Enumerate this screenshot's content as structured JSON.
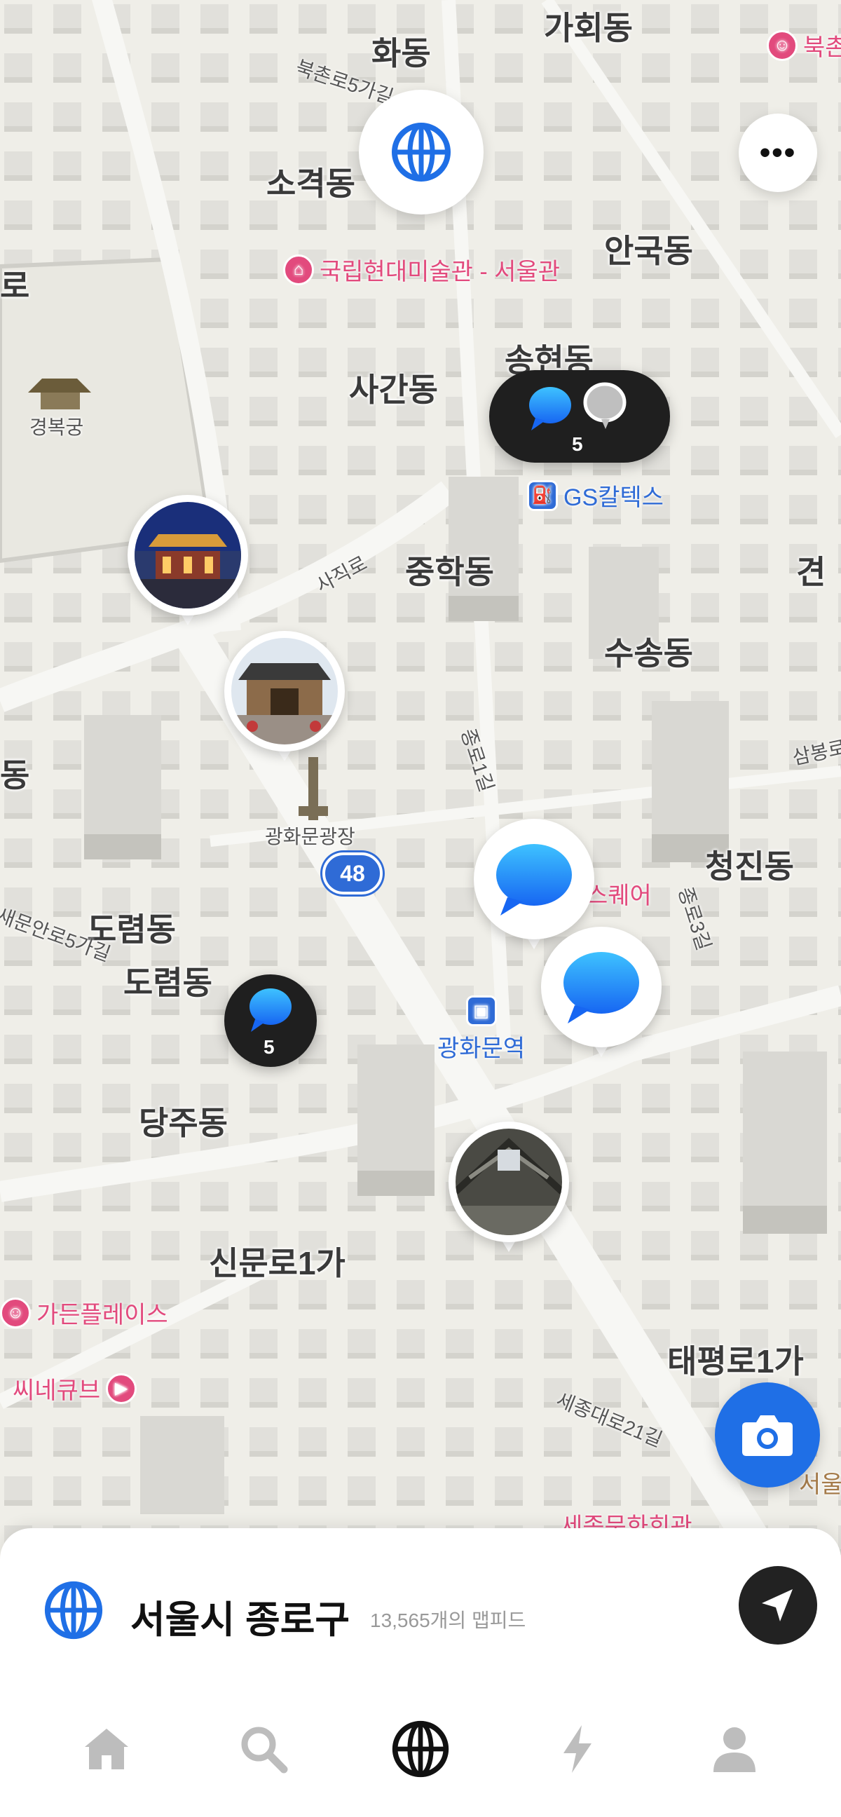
{
  "map": {
    "places": {
      "hwadong": "화동",
      "gahoedong": "가회동",
      "sogyeokdong": "소격동",
      "angukdong": "안국동",
      "saganDong": "사간동",
      "songhyeondong": "송현동",
      "junghakdong": "중학동",
      "susongdong": "수송동",
      "cheongjindong": "청진동",
      "dorimdong1": "도렴동",
      "dorimdong2": "도렴동",
      "dangjudong": "당주동",
      "sinmunro": "신문로1가",
      "taepyeongro": "태평로1가",
      "gyeongbokgung": "경복궁",
      "gwanghwamun_plaza": "광화문광장",
      "edge_ro": "로",
      "edge_dong": "동",
      "edge_gyeon": "견"
    },
    "roads": {
      "bukchon": "북촌로5가길",
      "sajik": "사직로",
      "jongro1": "종로1길",
      "sejong21": "세종대로21길",
      "jongro3": "종로3길",
      "saemunan": "새문안로5가길",
      "sambong": "삼봉로"
    },
    "pois": {
      "mmca": "국립현대미술관 - 서울관",
      "gs": "GS칼텍스",
      "gwanghwamun_station": "광화문역",
      "garden_place": "가든플레이스",
      "cinecube": "씨네큐브",
      "square": "스퀘어",
      "bukchon_edge": "북촌",
      "route48": "48",
      "sejong_center_edge": "세종문화회관",
      "seoul_edge": "서울"
    },
    "clusters": [
      {
        "count": "5"
      },
      {
        "count": "5"
      }
    ],
    "buttons": {
      "more_label": "•••"
    },
    "colors": {
      "accent": "#1f6fe6",
      "poi_pink": "#e24a7d",
      "dark": "#1f1f1f"
    }
  },
  "sheet": {
    "location_title": "서울시 종로구",
    "feed_count": "13,565개의 맵피드"
  },
  "tabs": [
    {
      "icon": "home-icon"
    },
    {
      "icon": "search-icon"
    },
    {
      "icon": "globe-icon"
    },
    {
      "icon": "bolt-icon"
    },
    {
      "icon": "profile-icon"
    }
  ]
}
